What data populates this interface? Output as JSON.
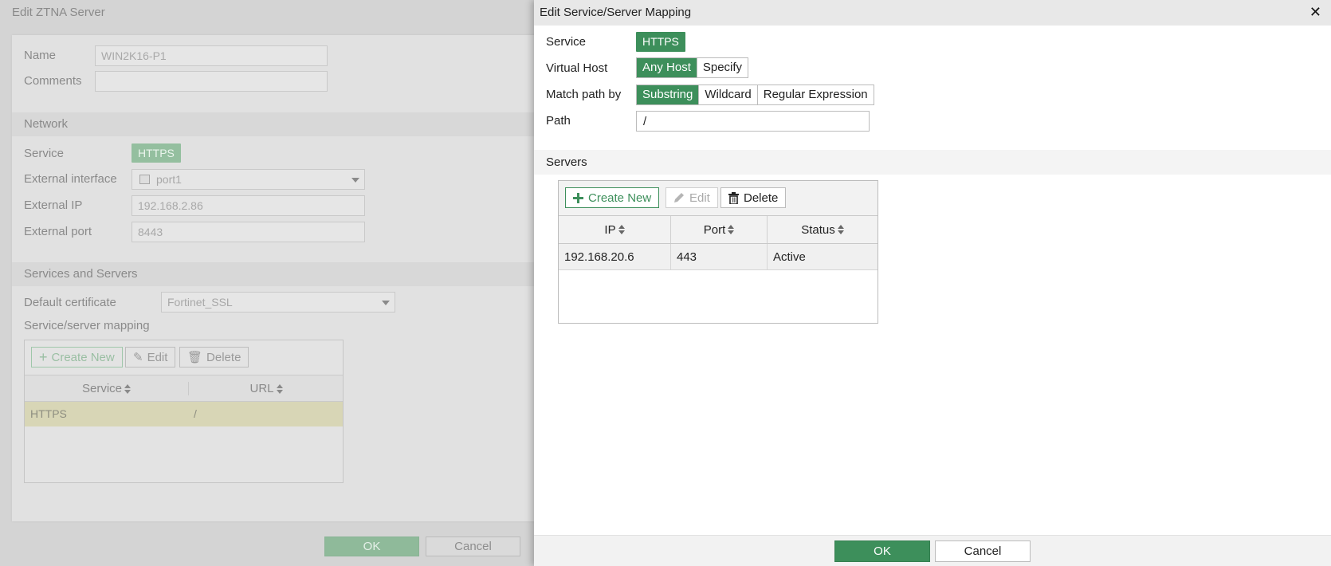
{
  "background_dialog": {
    "title": "Edit ZTNA Server",
    "name_label": "Name",
    "name_value": "WIN2K16-P1",
    "comments_label": "Comments",
    "comments_value": "",
    "network_section": "Network",
    "service_label": "Service",
    "service_value": "HTTPS",
    "external_interface_label": "External interface",
    "external_interface_value": "port1",
    "external_ip_label": "External IP",
    "external_ip_value": "192.168.2.86",
    "external_port_label": "External port",
    "external_port_value": "8443",
    "services_section": "Services and Servers",
    "default_certificate_label": "Default certificate",
    "default_certificate_value": "Fortinet_SSL",
    "mapping_label": "Service/server mapping",
    "toolbar": {
      "create_new": "Create New",
      "edit": "Edit",
      "delete": "Delete"
    },
    "table": {
      "columns": [
        "Service",
        "URL"
      ],
      "rows": [
        {
          "service": "HTTPS",
          "url": "/"
        }
      ]
    },
    "ok_label": "OK",
    "cancel_label": "Cancel"
  },
  "mapping_dialog": {
    "title": "Edit Service/Server Mapping",
    "service_label": "Service",
    "service_value": "HTTPS",
    "virtual_host_label": "Virtual Host",
    "virtual_host_options": [
      "Any Host",
      "Specify"
    ],
    "virtual_host_selected": "Any Host",
    "match_path_label": "Match path by",
    "match_path_options": [
      "Substring",
      "Wildcard",
      "Regular Expression"
    ],
    "match_path_selected": "Substring",
    "path_label": "Path",
    "path_value": "/",
    "servers_section": "Servers",
    "toolbar": {
      "create_new": "Create New",
      "edit": "Edit",
      "delete": "Delete"
    },
    "table": {
      "columns": [
        "IP",
        "Port",
        "Status"
      ],
      "rows": [
        {
          "ip": "192.168.20.6",
          "port": "443",
          "status": "Active"
        }
      ]
    },
    "ok_label": "OK",
    "cancel_label": "Cancel"
  },
  "colors": {
    "accent": "#3d8f5b",
    "dimmed_accent": "#94bf9f",
    "selected_row": "#d8d6b6"
  },
  "icons": [
    "plus-icon",
    "pencil-icon",
    "trash-icon",
    "close-icon",
    "sort-icon",
    "chevron-down-icon",
    "interface-icon"
  ]
}
